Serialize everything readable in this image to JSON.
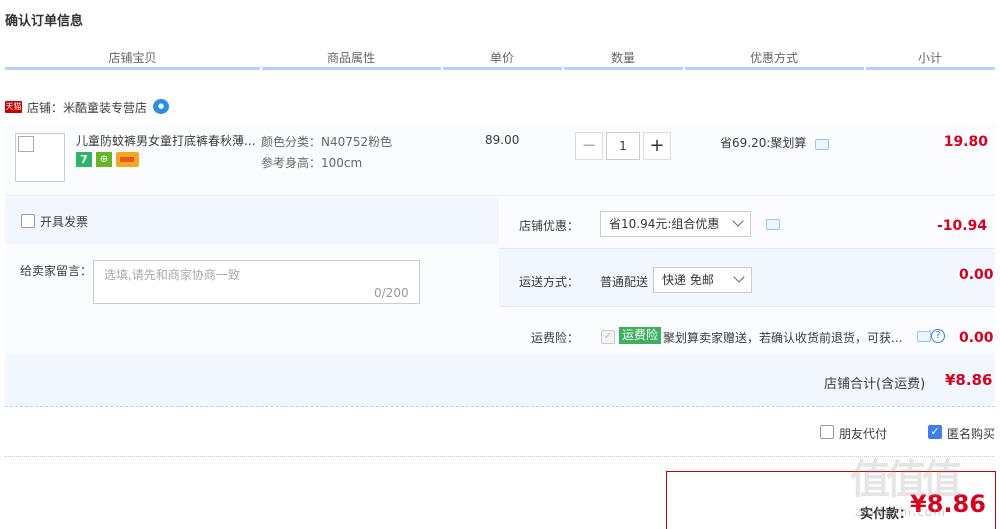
{
  "page_title": "确认订单信息",
  "columns": [
    "店铺宝贝",
    "商品属性",
    "单价",
    "数量",
    "优惠方式",
    "小计"
  ],
  "shop": {
    "badge": "天猫",
    "label": "店铺：米酷童装专营店"
  },
  "item": {
    "title": "儿童防蚊裤男女童打底裤春秋薄...",
    "tag_seven": "7",
    "attr_color": "颜色分类：N40752粉色",
    "attr_height": "参考身高：100cm",
    "unit_price": "89.00",
    "quantity": "1",
    "qty_minus": "−",
    "qty_plus": "+",
    "promo": "省69.20:聚划算",
    "subtotal": "19.80"
  },
  "invoice_label": "开具发票",
  "memo": {
    "label": "给卖家留言：",
    "placeholder": "选填,请先和商家协商一致",
    "count": "0/200"
  },
  "shop_discount": {
    "label": "店铺优惠：",
    "selected": "省10.94元:组合优惠",
    "value": "-10.94"
  },
  "shipping": {
    "label": "运送方式：",
    "method": "普通配送",
    "selected": "快递 免邮",
    "value": "0.00"
  },
  "insurance": {
    "label": "运费险：",
    "badge": "运费险",
    "text": "聚划算卖家赠送，若确认收货前退货，可获...",
    "value": "0.00"
  },
  "shop_total": {
    "label": "店铺合计(含运费)",
    "value": "¥8.86"
  },
  "options": {
    "friend_pay": "朋友代付",
    "anonymous": "匿名购买"
  },
  "payment": {
    "label": "实付款：",
    "value": "¥8.86"
  },
  "watermark": {
    "logo": "值值值",
    "site": "zhidezhi.com"
  }
}
